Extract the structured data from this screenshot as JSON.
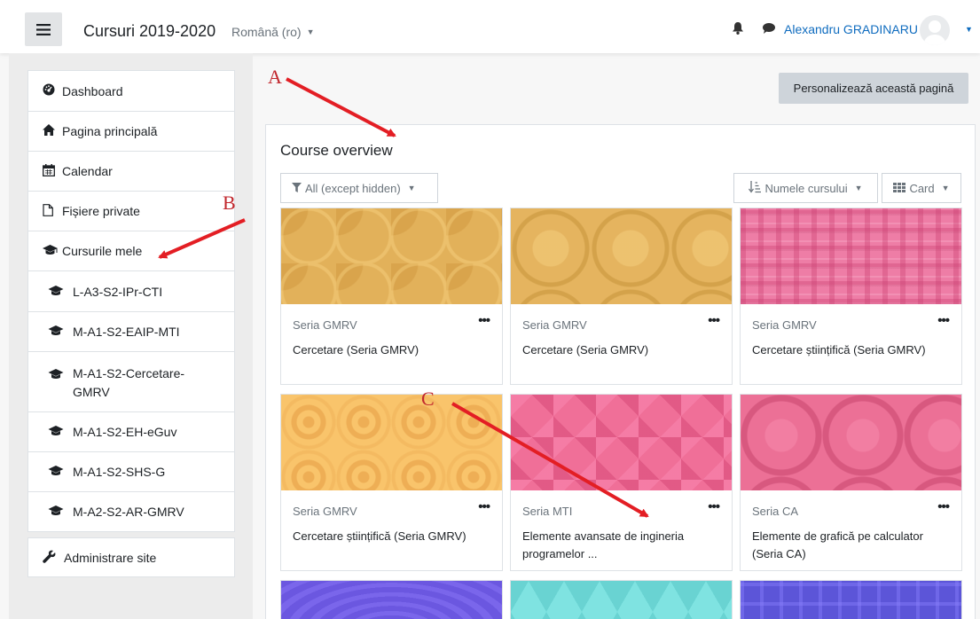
{
  "navbar": {
    "menu_icon": "hamburger-icon",
    "site_name": "Cursuri 2019-2020",
    "language": "Română (ro)",
    "bell_icon": "bell-icon",
    "chat_icon": "chat-icon",
    "username": "Alexandru GRADINARU"
  },
  "nav": {
    "items": [
      {
        "label": "Dashboard",
        "icon": "dashboard-icon"
      },
      {
        "label": "Pagina principală",
        "icon": "home-icon"
      },
      {
        "label": "Calendar",
        "icon": "calendar-icon"
      },
      {
        "label": "Fișiere private",
        "icon": "file-icon"
      },
      {
        "label": "Cursurile mele",
        "icon": "graduation-cap-icon"
      }
    ],
    "courses": [
      {
        "label": "L-A3-S2-IPr-CTI"
      },
      {
        "label": "M-A1-S2-EAIP-MTI"
      },
      {
        "label": "M-A1-S2-Cercetare-GMRV"
      },
      {
        "label": "M-A1-S2-EH-eGuv"
      },
      {
        "label": "M-A1-S2-SHS-G"
      },
      {
        "label": "M-A2-S2-AR-GMRV"
      }
    ],
    "admin": {
      "label": "Administrare site",
      "icon": "wrench-icon"
    }
  },
  "main": {
    "customize_button": "Personalizează această pagină",
    "block_title": "Course overview",
    "filter": "All (except hidden)",
    "sort": "Numele cursului",
    "view": "Card",
    "courses": [
      {
        "category": "Seria GMRV",
        "name": "Cercetare (Seria GMRV)"
      },
      {
        "category": "Seria GMRV",
        "name": "Cercetare (Seria GMRV)"
      },
      {
        "category": "Seria GMRV",
        "name": "Cercetare științifică (Seria GMRV)"
      },
      {
        "category": "Seria GMRV",
        "name": "Cercetare științifică (Seria GMRV)"
      },
      {
        "category": "Seria MTI",
        "name": "Elemente avansate de ingineria programelor ..."
      },
      {
        "category": "Seria CA",
        "name": "Elemente de grafică pe calculator (Seria CA)"
      }
    ],
    "more_menu": "•••"
  },
  "annotations": {
    "a": "A",
    "b": "B",
    "c": "C",
    "color": "#e31e24"
  }
}
